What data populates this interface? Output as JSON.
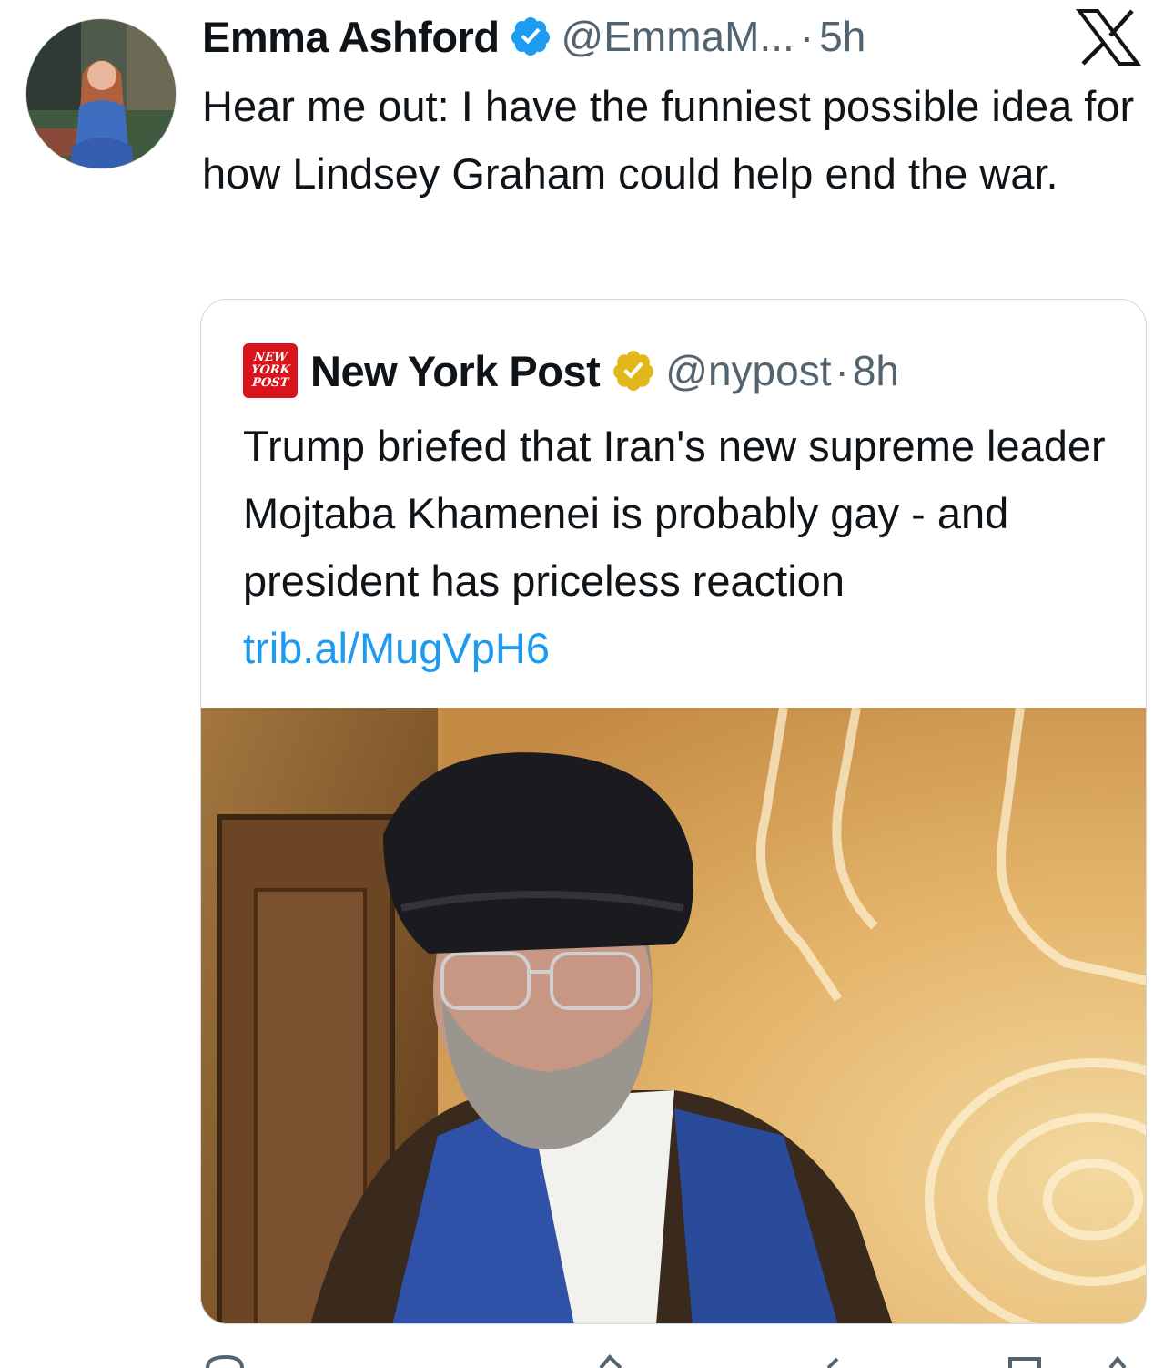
{
  "tweet": {
    "author_name": "Emma Ashford",
    "handle": "@EmmaM...",
    "separator": "·",
    "time": "5h",
    "text": "Hear me out: I have the funniest possible idea for how Lindsey Graham could help end the war."
  },
  "quote": {
    "source_logo_lines": [
      "NEW",
      "YORK",
      "POST"
    ],
    "author_name": "New York Post",
    "handle": "@nypost",
    "separator": "·",
    "time": "8h",
    "text": "Trump briefed that Iran's new supreme leader Mojtaba Khamenei is probably gay - and president has priceless reaction",
    "link": "trib.al/MugVpH6"
  },
  "icons": {
    "verified": "blue-verified-check-icon",
    "business": "gold-verified-check-icon",
    "platform": "x-logo-icon"
  },
  "colors": {
    "text": "#0f1419",
    "secondary": "#536471",
    "link": "#1d9bf0",
    "verified_blue": "#1d9bf0",
    "verified_gold": "#e2b719",
    "nypost_red": "#d9141b"
  }
}
